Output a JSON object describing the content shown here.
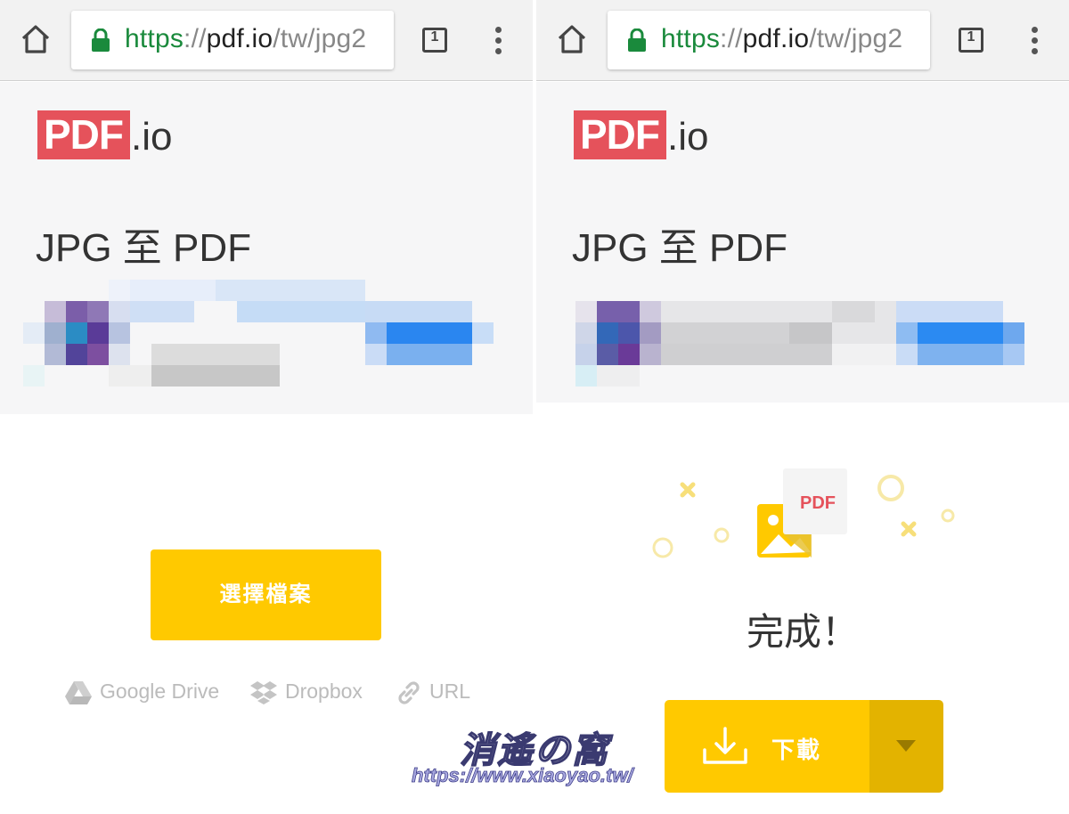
{
  "browser": {
    "url_scheme": "https",
    "url_separator": "://",
    "url_host": "pdf.io",
    "url_path": "/tw/jpg2",
    "tab_count": "1",
    "icons": {
      "home": "home-icon",
      "lock": "lock-icon",
      "tabs": "tab-switcher-icon",
      "menu": "overflow-menu-icon"
    }
  },
  "brand": {
    "logo_mark": "PDF",
    "logo_suffix": ".io",
    "accent": "#e5525b",
    "button_yellow": "#ffc900"
  },
  "left_screen": {
    "title": "JPG 至 PDF",
    "primary_button": "選擇檔案",
    "sources": [
      {
        "label": "Google Drive",
        "icon": "google-drive-icon"
      },
      {
        "label": "Dropbox",
        "icon": "dropbox-icon"
      },
      {
        "label": "URL",
        "icon": "link-icon"
      }
    ]
  },
  "right_screen": {
    "title": "JPG 至 PDF",
    "illustration_label": "PDF",
    "done_text": "完成！",
    "download_label": "下載",
    "icons": {
      "download": "download-icon",
      "dropdown": "caret-down-icon"
    }
  },
  "watermark": {
    "script_text": "消遙の窩",
    "url": "https://www.xiaoyao.tw/"
  }
}
